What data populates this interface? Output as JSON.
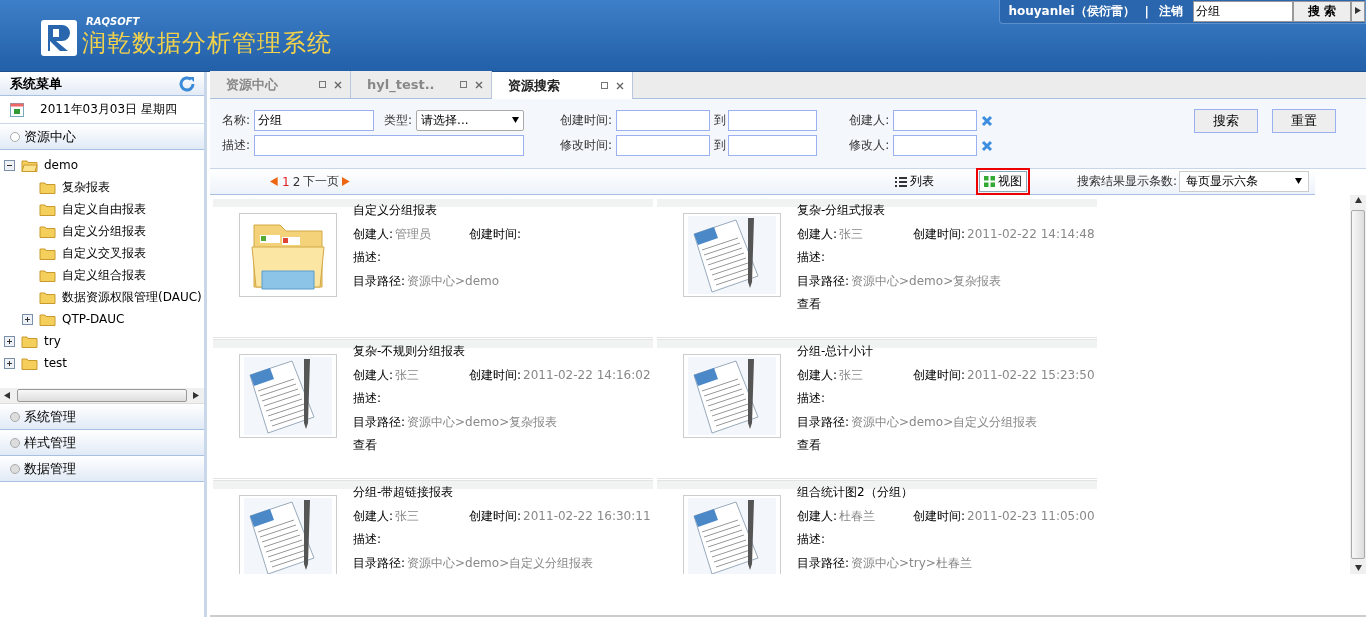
{
  "header": {
    "brand": "RAQSOFT",
    "title": "润乾数据分析管理系统",
    "user": "houyanlei（侯衍雷）",
    "separator": "|",
    "logout": "注销",
    "search_value": "分组",
    "search_button": "搜 索"
  },
  "sidebar": {
    "title": "系统菜单",
    "date": "2011年03月03日  星期四",
    "sections": [
      {
        "label": "资源中心",
        "expanded": true,
        "tree": [
          {
            "label": "demo",
            "expanded": true,
            "children": [
              {
                "label": "复杂报表"
              },
              {
                "label": "自定义自由报表"
              },
              {
                "label": "自定义分组报表"
              },
              {
                "label": "自定义交叉报表"
              },
              {
                "label": "自定义组合报表"
              },
              {
                "label": "数据资源权限管理(DAUC)"
              },
              {
                "label": "QTP-DAUC",
                "expanded": false
              }
            ]
          },
          {
            "label": "try",
            "expanded": false
          },
          {
            "label": "test",
            "expanded": false
          }
        ]
      },
      {
        "label": "系统管理",
        "expanded": false
      },
      {
        "label": "样式管理",
        "expanded": false
      },
      {
        "label": "数据管理",
        "expanded": false
      }
    ]
  },
  "tabs": [
    {
      "label": "资源中心",
      "selected": false
    },
    {
      "label": "hyl_test..",
      "selected": false
    },
    {
      "label": "资源搜索",
      "selected": true
    }
  ],
  "form": {
    "name_label": "名称:",
    "name_value": "分组",
    "type_label": "类型:",
    "type_value": "请选择...",
    "desc_label": "描述:",
    "created_label": "创建时间:",
    "modified_label": "修改时间:",
    "to_label": "到",
    "to_label_2": "到",
    "creator_label": "创建人:",
    "modifier_label": "修改人:",
    "search_button": "搜索",
    "reset_button": "重置"
  },
  "pager": {
    "pages": [
      {
        "label": "1",
        "selected": true
      },
      {
        "label": "2",
        "selected": false
      }
    ],
    "next": "下一页"
  },
  "views": [
    {
      "kind": "list",
      "label": "列表",
      "selected": false
    },
    {
      "kind": "grid",
      "label": "视图",
      "selected": true
    }
  ],
  "page_size": {
    "label": "搜索结果显示条数:",
    "value": "每页显示六条"
  },
  "cards": [
    {
      "kind": "folder",
      "title": "自定义分组报表",
      "creator_label": "创建人:",
      "creator": "管理员",
      "time_label": "创建时间:",
      "desc_label": "描述:",
      "path_label": "目录路径:",
      "path": "资源中心>demo"
    },
    {
      "kind": "file",
      "title": "复杂-分组式报表",
      "creator_label": "创建人:",
      "creator": "张三",
      "time_label": "创建时间:",
      "time": "2011-02-22 14:14:48",
      "desc_label": "描述:",
      "path_label": "目录路径:",
      "path": "资源中心>demo>复杂报表",
      "view": "查看"
    },
    {
      "kind": "file",
      "title": "复杂-不规则分组报表",
      "creator_label": "创建人:",
      "creator": "张三",
      "time_label": "创建时间:",
      "time": "2011-02-22 14:16:02",
      "desc_label": "描述:",
      "path_label": "目录路径:",
      "path": "资源中心>demo>复杂报表",
      "view": "查看"
    },
    {
      "kind": "file",
      "title": "分组-总计小计",
      "creator_label": "创建人:",
      "creator": "张三",
      "time_label": "创建时间:",
      "time": "2011-02-22 15:23:50",
      "desc_label": "描述:",
      "path_label": "目录路径:",
      "path": "资源中心>demo>自定义分组报表",
      "view": "查看"
    },
    {
      "kind": "file",
      "title": "分组-带超链接报表",
      "creator_label": "创建人:",
      "creator": "张三",
      "time_label": "创建时间:",
      "time": "2011-02-22 16:30:11",
      "desc_label": "描述:",
      "path_label": "目录路径:",
      "path": "资源中心>demo>自定义分组报表"
    },
    {
      "kind": "file",
      "title": "组合统计图2（分组）",
      "creator_label": "创建人:",
      "creator": "杜春兰",
      "time_label": "创建时间:",
      "time": "2011-02-23 11:05:00",
      "desc_label": "描述:",
      "path_label": "目录路径:",
      "path": "资源中心>try>杜春兰"
    }
  ]
}
